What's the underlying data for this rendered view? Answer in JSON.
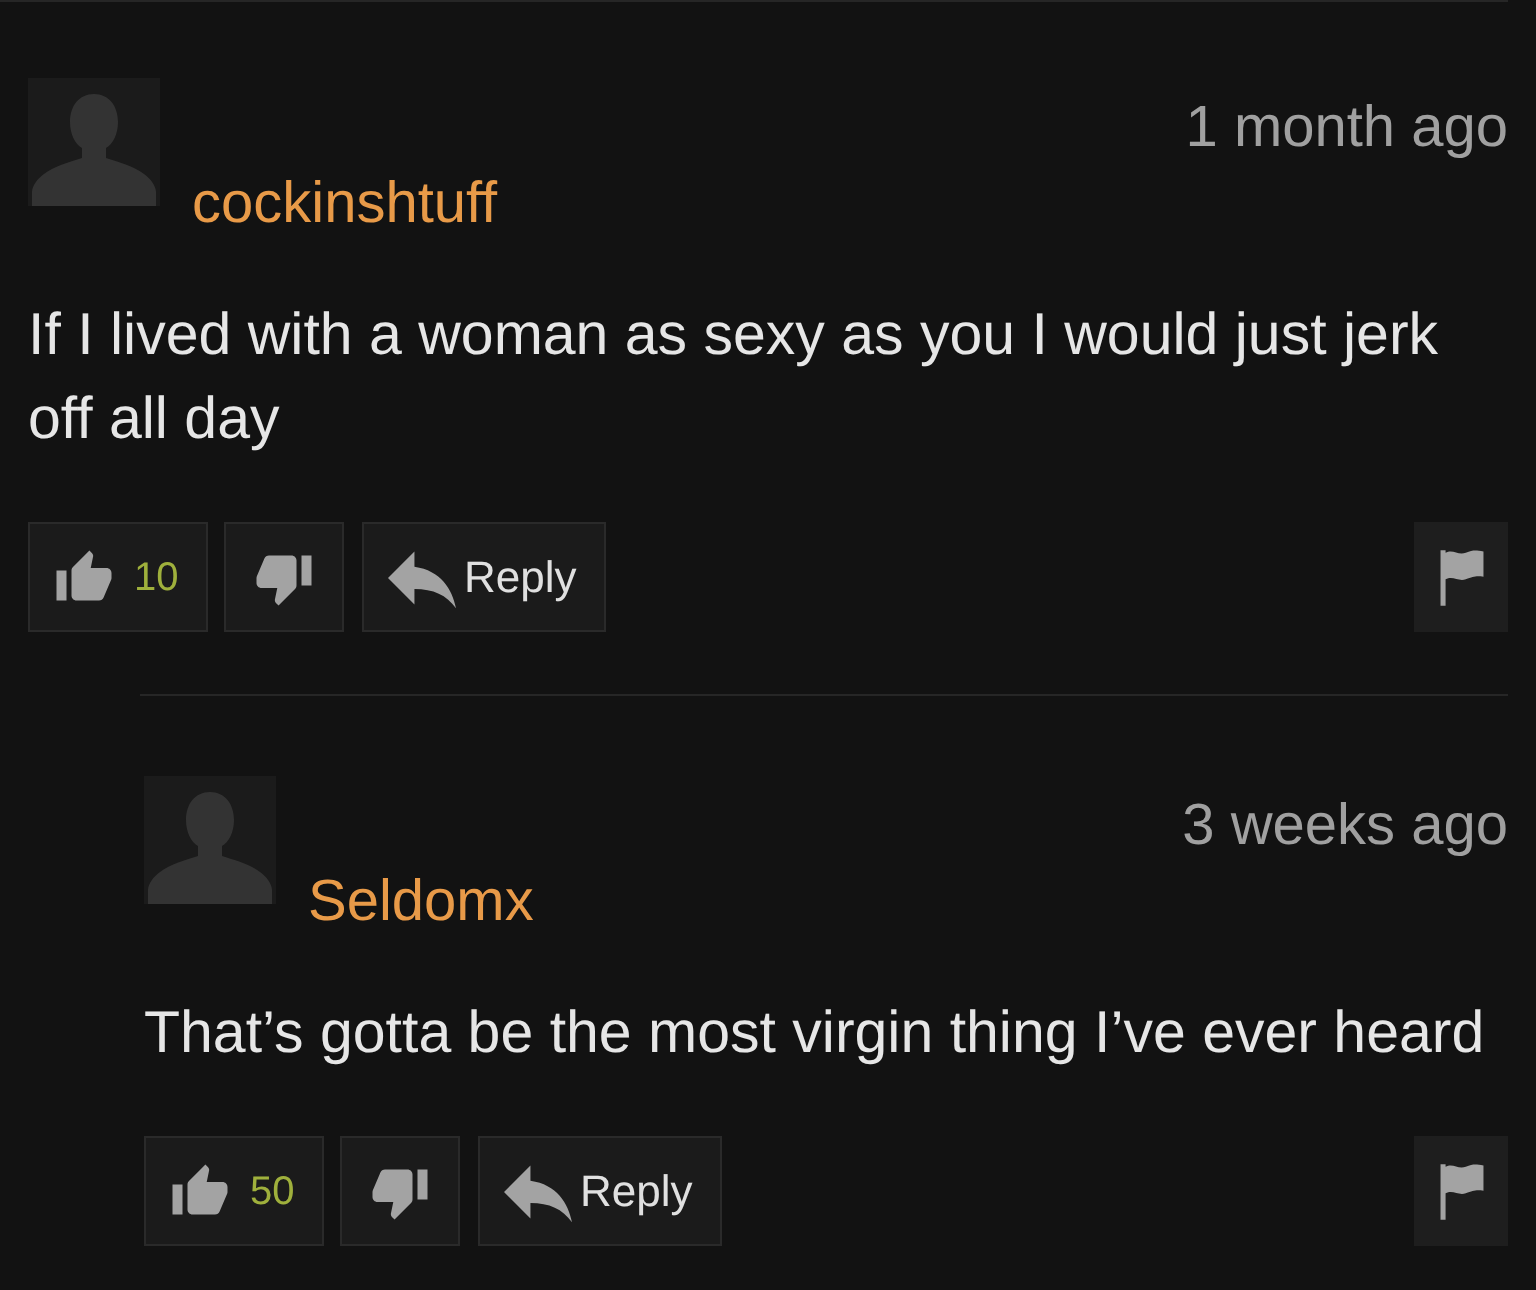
{
  "comments": [
    {
      "username": "cockinshtuff",
      "time": "1 month ago",
      "text": "If I lived with a woman as sexy as you I would just jerk off all day",
      "likes": "10",
      "reply_button": "Reply",
      "replies": [
        {
          "username": "Seldomx",
          "time": "3 weeks ago",
          "text": "That’s gotta be the most virgin thing I’ve ever heard",
          "likes": "50",
          "reply_button": "Reply"
        }
      ]
    }
  ]
}
